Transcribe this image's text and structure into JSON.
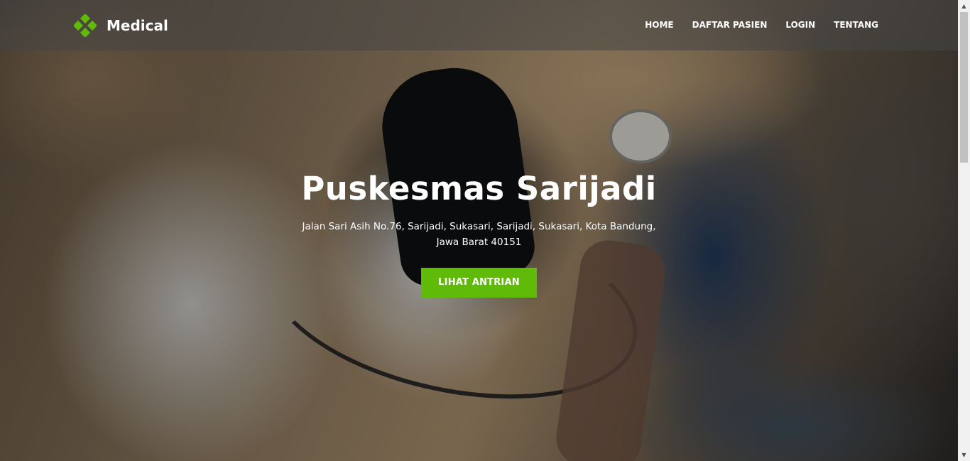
{
  "brand": {
    "name": "Medical",
    "icon": "medical-cross-icon",
    "accent_color": "#5fbb07"
  },
  "nav": {
    "items": [
      "HOME",
      "DAFTAR PASIEN",
      "LOGIN",
      "TENTANG"
    ]
  },
  "hero": {
    "title": "Puskesmas Sarijadi",
    "address": "Jalan Sari Asih No.76, Sarijadi, Sukasari, Sarijadi, Sukasari, Kota Bandung, Jawa Barat 40151",
    "cta_label": "LIHAT ANTRIAN",
    "cta_color": "#5fbb07"
  },
  "scrollbar": {
    "up_icon": "scroll-up-icon",
    "down_icon": "scroll-down-icon"
  }
}
